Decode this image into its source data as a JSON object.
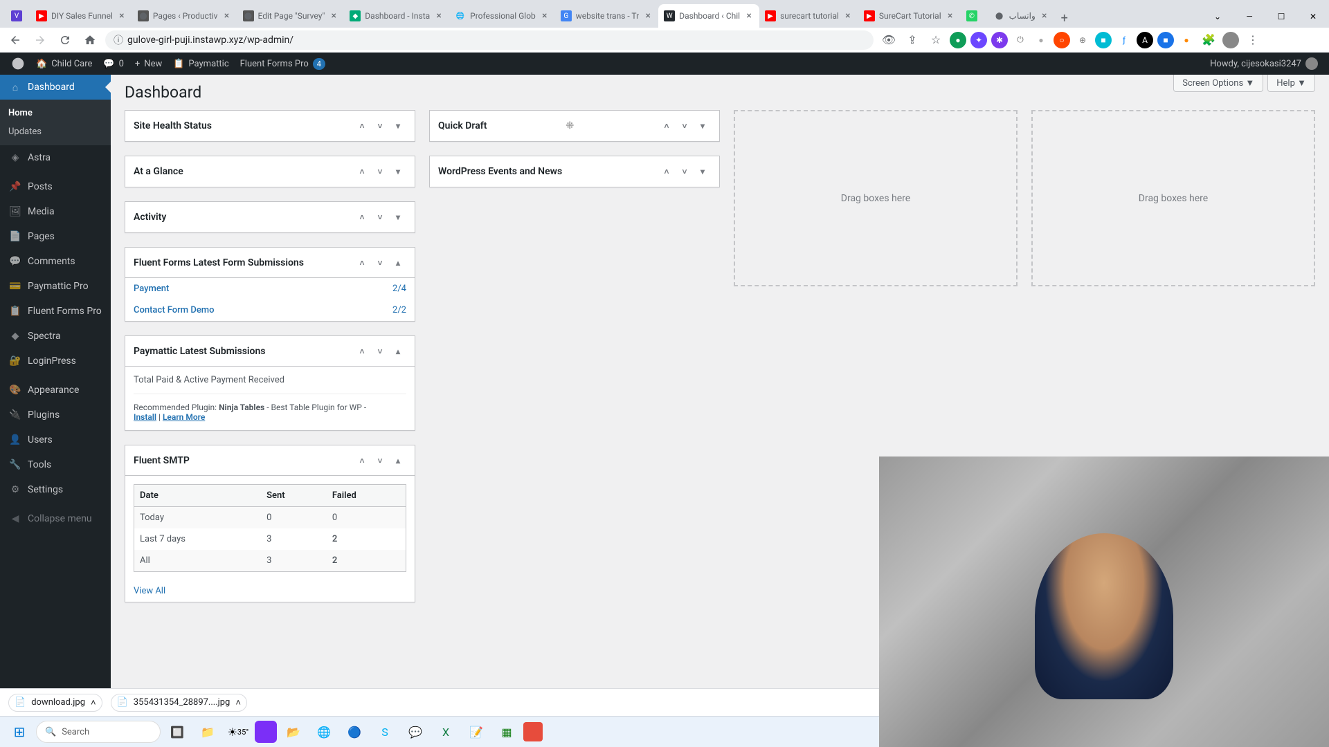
{
  "browser": {
    "tabs": [
      {
        "title": "",
        "favicon": "#1a73e8"
      },
      {
        "title": "DIY Sales Funnel",
        "favicon": "#ff0000"
      },
      {
        "title": "Pages ‹ Productiv",
        "favicon": "#777"
      },
      {
        "title": "Edit Page \"Survey\"",
        "favicon": "#777"
      },
      {
        "title": "Dashboard - Insta",
        "favicon": "#0a7"
      },
      {
        "title": "Professional Glob",
        "favicon": "#888"
      },
      {
        "title": "website trans - Tr",
        "favicon": "#4285f4"
      },
      {
        "title": "Dashboard ‹ Chil",
        "favicon": "#777",
        "active": true
      },
      {
        "title": "surecart tutorial",
        "favicon": "#ff0000"
      },
      {
        "title": "SureCart Tutorial",
        "favicon": "#ff0000"
      },
      {
        "title": "",
        "favicon": "#25d366"
      },
      {
        "title": "واتساب",
        "favicon": "#888"
      }
    ],
    "url": "gulove-girl-puji.instawp.xyz/wp-admin/"
  },
  "adminbar": {
    "site": "Child Care",
    "comments": "0",
    "new": "New",
    "paymattic": "Paymattic",
    "fluent": "Fluent Forms Pro",
    "fluent_badge": "4",
    "howdy": "Howdy, cijesokasi3247"
  },
  "sidebar": {
    "items": [
      {
        "label": "Dashboard",
        "icon": "dash"
      },
      {
        "label": "Astra",
        "icon": "astra"
      },
      {
        "label": "Posts",
        "icon": "posts"
      },
      {
        "label": "Media",
        "icon": "media"
      },
      {
        "label": "Pages",
        "icon": "pages"
      },
      {
        "label": "Comments",
        "icon": "comments"
      },
      {
        "label": "Paymattic Pro",
        "icon": "pay"
      },
      {
        "label": "Fluent Forms Pro",
        "icon": "fluent"
      },
      {
        "label": "Spectra",
        "icon": "spectra"
      },
      {
        "label": "LoginPress",
        "icon": "login"
      },
      {
        "label": "Appearance",
        "icon": "appear"
      },
      {
        "label": "Plugins",
        "icon": "plugins"
      },
      {
        "label": "Users",
        "icon": "users"
      },
      {
        "label": "Tools",
        "icon": "tools"
      },
      {
        "label": "Settings",
        "icon": "settings"
      },
      {
        "label": "Collapse menu",
        "icon": "collapse"
      }
    ],
    "submenu": {
      "home": "Home",
      "updates": "Updates"
    }
  },
  "page": {
    "title": "Dashboard",
    "screen_options": "Screen Options",
    "help": "Help",
    "dragboxes": "Drag boxes here"
  },
  "widgets": {
    "site_health": "Site Health Status",
    "at_glance": "At a Glance",
    "activity": "Activity",
    "fluent_forms": {
      "title": "Fluent Forms Latest Form Submissions",
      "rows": [
        {
          "name": "Payment",
          "count": "2/4"
        },
        {
          "name": "Contact Form Demo",
          "count": "2/2"
        }
      ]
    },
    "paymattic": {
      "title": "Paymattic Latest Submissions",
      "label": "Total Paid & Active Payment Received",
      "rec_prefix": "Recommended Plugin: ",
      "rec_name": "Ninja Tables",
      "rec_suffix": " - Best Table Plugin for WP - ",
      "install": "Install",
      "sep": " | ",
      "learn": "Learn More"
    },
    "smtp": {
      "title": "Fluent SMTP",
      "headers": {
        "date": "Date",
        "sent": "Sent",
        "failed": "Failed"
      },
      "rows": [
        {
          "date": "Today",
          "sent": "0",
          "failed": "0"
        },
        {
          "date": "Last 7 days",
          "sent": "3",
          "failed": "2"
        },
        {
          "date": "All",
          "sent": "3",
          "failed": "2"
        }
      ],
      "view_all": "View All"
    },
    "quick_draft": "Quick Draft",
    "events": "WordPress Events and News"
  },
  "downloads": {
    "items": [
      {
        "name": "download.jpg"
      },
      {
        "name": "355431354_28897....jpg"
      }
    ]
  },
  "taskbar": {
    "search": "Search",
    "temp": "35°"
  }
}
